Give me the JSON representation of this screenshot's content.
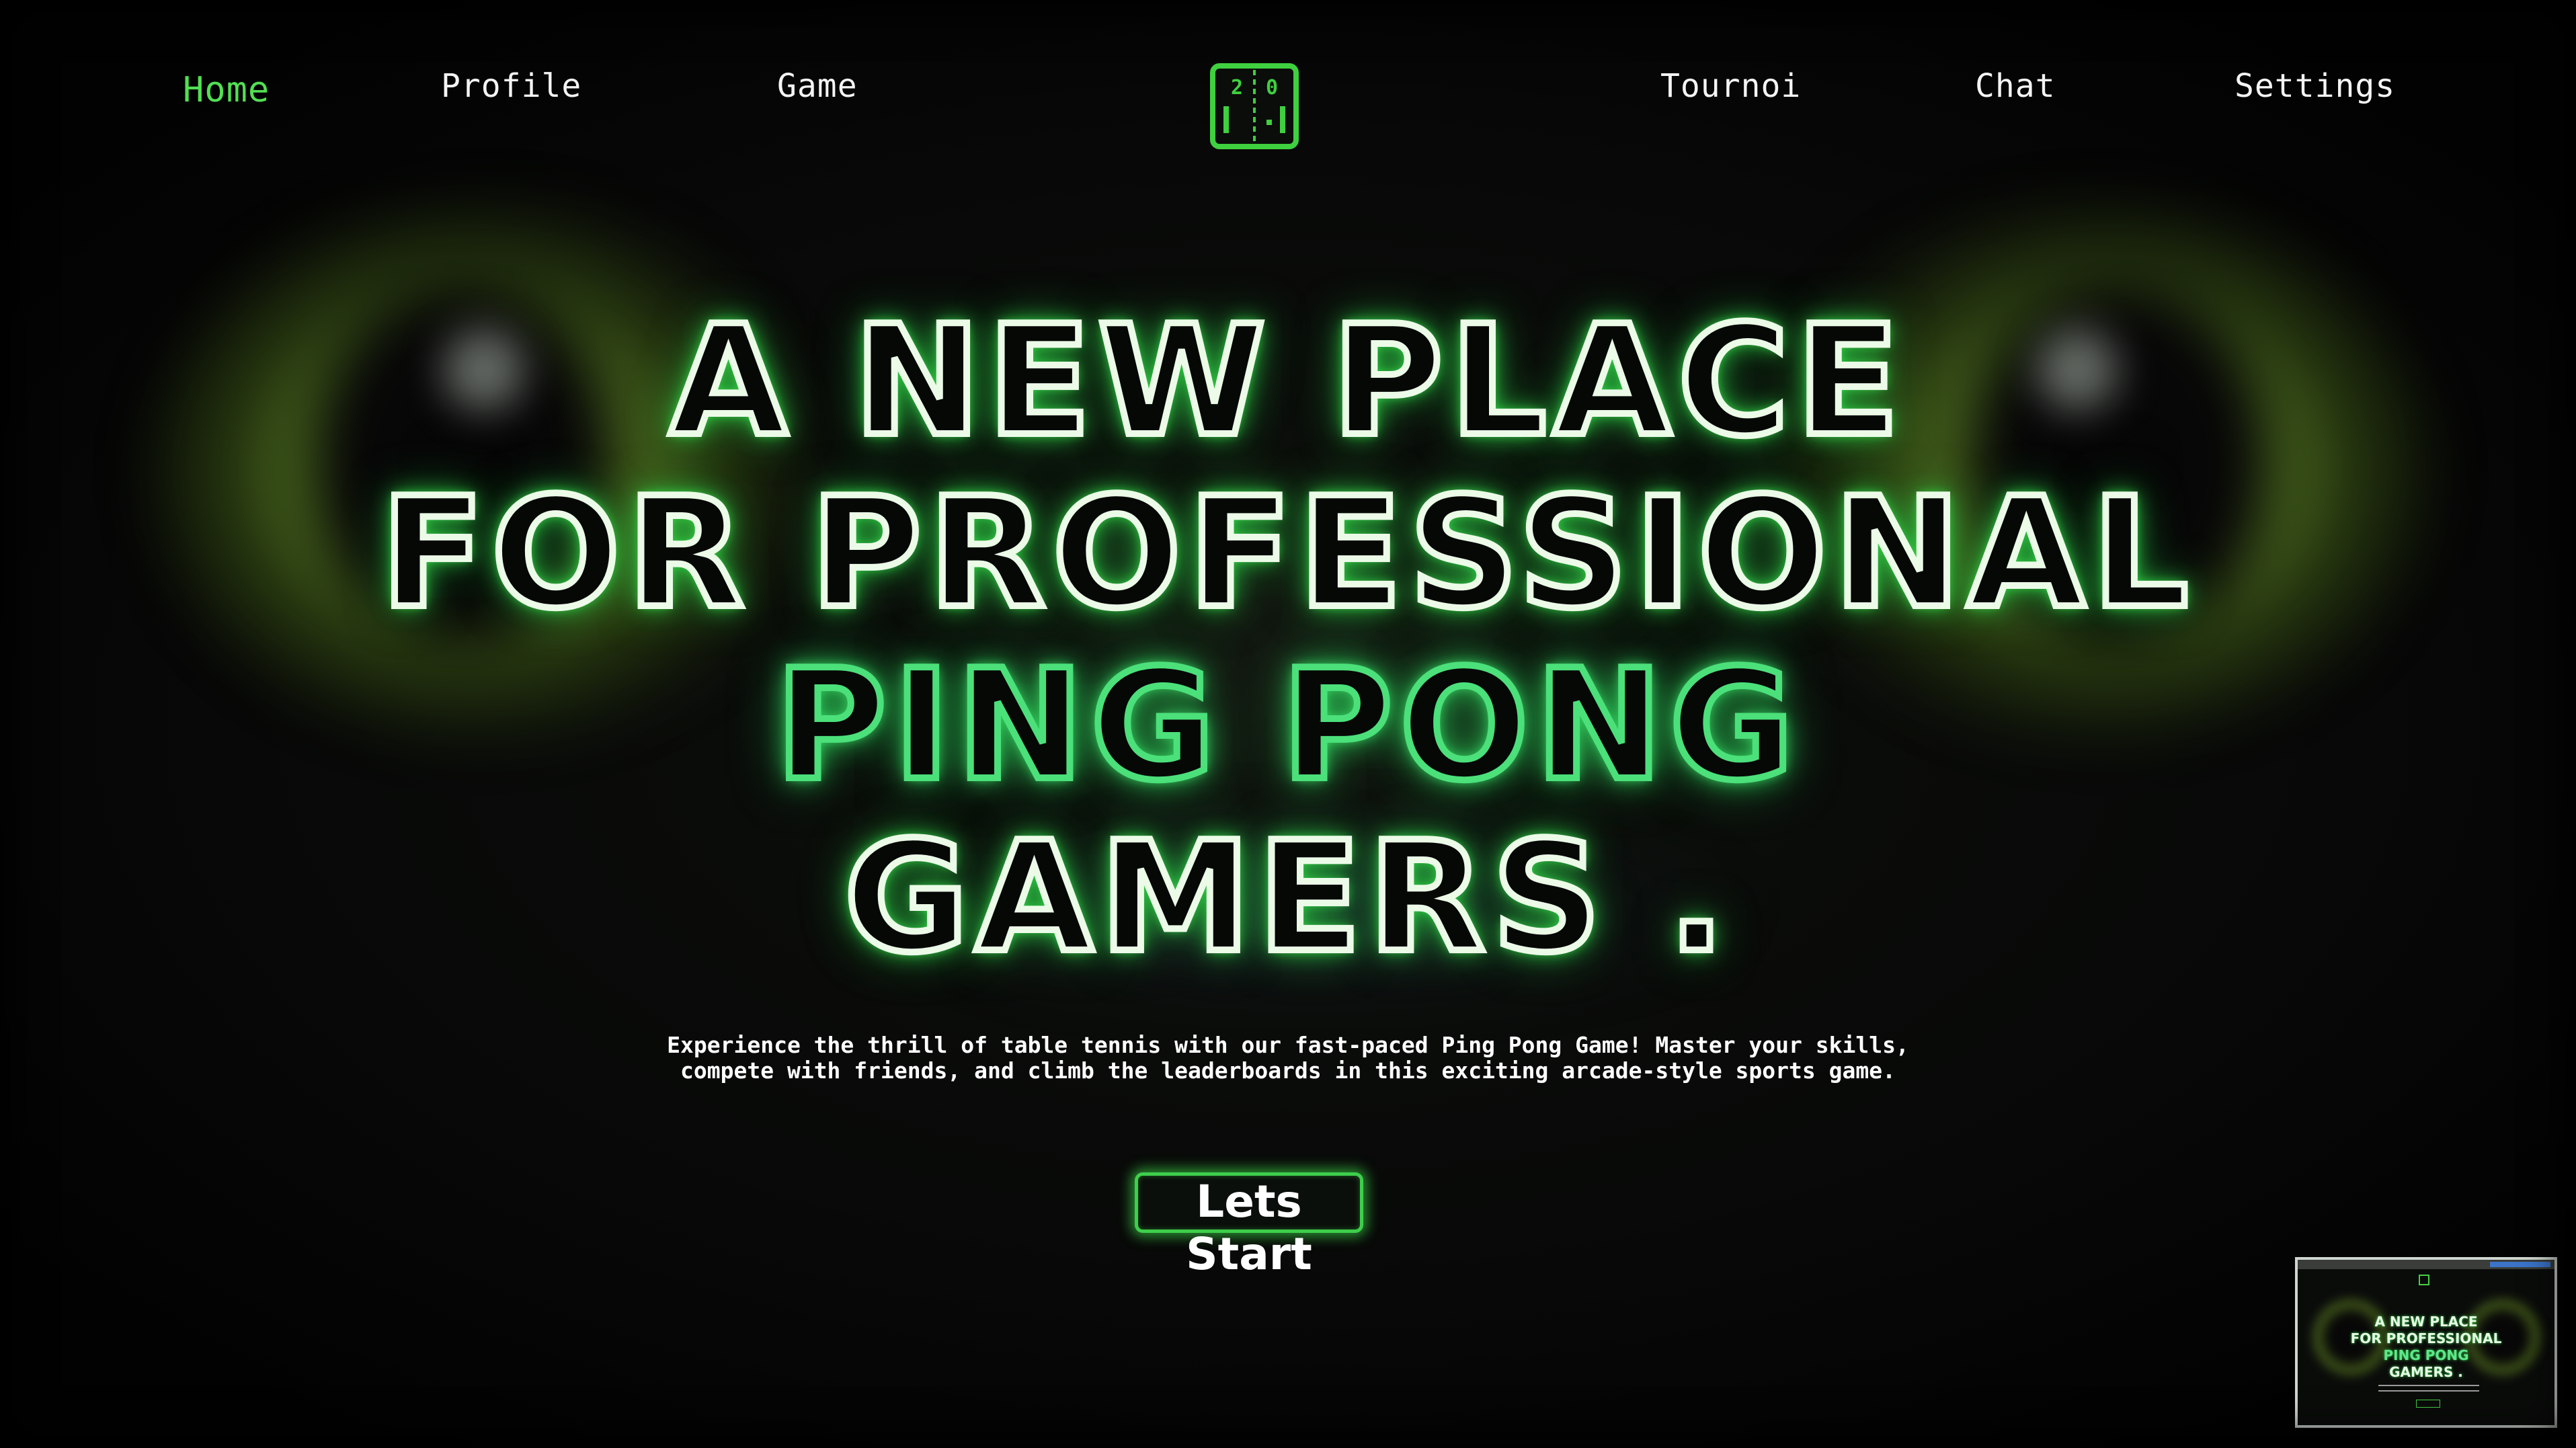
{
  "nav": {
    "home": "Home",
    "profile": "Profile",
    "game": "Game",
    "tournoi": "Tournoi",
    "chat": "Chat",
    "settings": "Settings",
    "active": "Home"
  },
  "logo": {
    "icon": "ping-pong-scoreboard-icon",
    "score_left": "2",
    "score_right": "0"
  },
  "hero": {
    "line1": "A NEW PLACE",
    "line2": "FOR PROFESSIONAL",
    "line3": "PING PONG",
    "line4": "GAMERS ."
  },
  "description": "Experience the thrill of table tennis with our fast-paced Ping Pong Game! Master your skills, compete with friends, and climb the leaderboards in this exciting arcade-style sports game.",
  "cta": {
    "label": "Lets Start"
  },
  "preview": {
    "line1": "A NEW PLACE",
    "line2": "FOR PROFESSIONAL",
    "line3": "PING PONG",
    "line4": "GAMERS ."
  },
  "colors": {
    "accent": "#52e052",
    "neon_green": "#4be07a",
    "text": "#f4f4f4",
    "background": "#050605"
  }
}
